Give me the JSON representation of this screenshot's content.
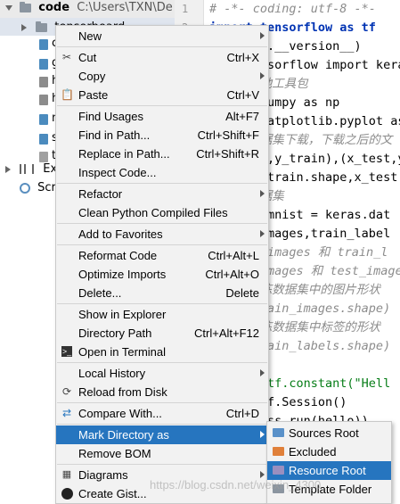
{
  "tree": {
    "root_label": "code",
    "root_path": "C:\\Users\\TXN\\De",
    "selected_item": "tensorboard",
    "items": [
      "c",
      "g",
      "h",
      "h",
      "n",
      "s",
      "t"
    ],
    "external_label": "Exte",
    "scratches_label": "Scra"
  },
  "gutter": {
    "line1": "1",
    "line2": "2"
  },
  "editor": {
    "lines": [
      "# -*- coding: utf-8 -*-",
      "import tensorflow as tf",
      "print(tf.__version__)",
      "from tensorflow import kera",
      "# 导入其他工具包",
      "import numpy as np",
      "import matplotlib.pyplot as",
      "# 加载数据集下载，下载之后的文",
      "(x_train,y_train),(x_test,y_test) = k",
      "print(x_train.shape,x_test.shap",
      "# 导入数据集",
      "fashion_mnist = keras.dat",
      "(train_images,train_label",
      "# train_images 和 train_l",
      "# test_images 和 test_images 和 te",
      "# 打印训练数据集中的图片形状",
      "print(train_images.shape)",
      "# 打印训练数据集中标签的形状",
      "print(train_labels.shape)",
      "",
      "hello = tf.constant(\"Hell",
      "sess = tf.Session()",
      "print(sess.run(hello))",
      "",
      "",
      ""
    ]
  },
  "menu": {
    "new": "New",
    "cut": "Cut",
    "cut_sc": "Ctrl+X",
    "copy": "Copy",
    "paste": "Paste",
    "paste_sc": "Ctrl+V",
    "find_usages": "Find Usages",
    "find_usages_sc": "Alt+F7",
    "find_in_path": "Find in Path...",
    "find_in_path_sc": "Ctrl+Shift+F",
    "replace_in_path": "Replace in Path...",
    "replace_in_path_sc": "Ctrl+Shift+R",
    "inspect_code": "Inspect Code...",
    "refactor": "Refactor",
    "clean_compiled": "Clean Python Compiled Files",
    "add_favorites": "Add to Favorites",
    "reformat": "Reformat Code",
    "reformat_sc": "Ctrl+Alt+L",
    "optimize": "Optimize Imports",
    "optimize_sc": "Ctrl+Alt+O",
    "delete": "Delete...",
    "delete_sc": "Delete",
    "show_explorer": "Show in Explorer",
    "directory_path": "Directory Path",
    "directory_path_sc": "Ctrl+Alt+F12",
    "open_terminal": "Open in Terminal",
    "local_history": "Local History",
    "reload_disk": "Reload from Disk",
    "compare_with": "Compare With...",
    "compare_with_sc": "Ctrl+D",
    "mark_directory": "Mark Directory as",
    "remove_bom": "Remove BOM",
    "diagrams": "Diagrams",
    "create_gist": "Create Gist..."
  },
  "submenu": {
    "sources_root": "Sources Root",
    "excluded": "Excluded",
    "resource_root": "Resource Root",
    "template_folder": "Template Folder"
  },
  "colors": {
    "menu_bg": "#f2f2f2",
    "selection": "#2675bf",
    "sources_root_icon": "#5a91c9",
    "excluded_icon": "#e0803a",
    "resource_root_icon": "#9a8fbf",
    "template_folder_icon": "#8b95a0"
  },
  "watermark": "https://blog.csdn.net/weixin_4300"
}
